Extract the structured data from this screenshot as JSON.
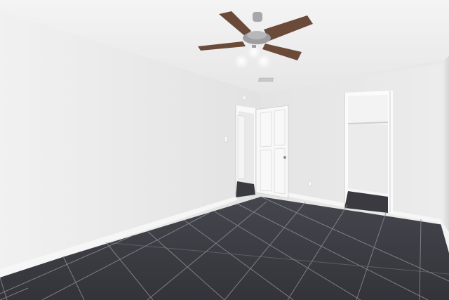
{
  "scene": {
    "subject": "empty-bedroom",
    "elements": [
      "ceiling-fan",
      "ceiling-light-kit",
      "interior-door",
      "open-doorway-hallway",
      "walk-in-closet",
      "air-vent",
      "light-switch",
      "wall-outlet",
      "tile-floor",
      "baseboards"
    ],
    "colors": {
      "ceiling": "#f2f2f2",
      "left_wall": "#ececec",
      "back_wall": "#e4e4e4",
      "right_wall": "#dcdcdc",
      "floor_tile": "#3d3d45",
      "grout": "#8a8a8f",
      "fan_blade": "#6b4a3a",
      "fan_metal": "#a8a8ac",
      "door": "#f7f7f7"
    }
  }
}
